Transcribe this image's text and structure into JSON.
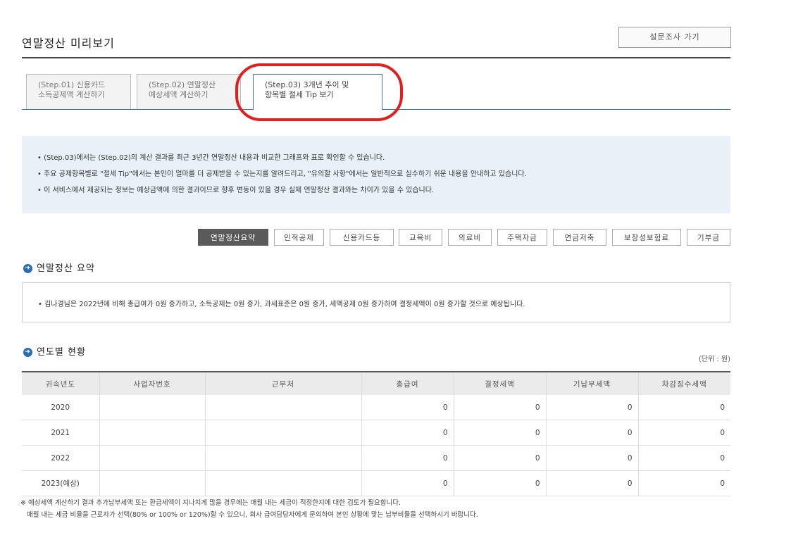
{
  "header": {
    "title": "연말정산 미리보기",
    "survey_button": "설문조사 가기"
  },
  "steps": [
    {
      "line1": "(Step.01) 신용카드",
      "line2": "소득공제액 계산하기"
    },
    {
      "line1": "(Step.02) 연말정산",
      "line2": "예상세액 계산하기"
    },
    {
      "line1": "(Step.03) 3개년 추이 및",
      "line2": "항목별 절세 Tip 보기"
    }
  ],
  "info": [
    "• (Step.03)에서는 (Step.02)의 계산 결과를 최근 3년간 연말정산 내용과 비교한 그래프와 표로 확인할 수 있습니다.",
    "• 주요 공제항목별로 \"절세 Tip\"에서는 본인이 얼마를 더 공제받을 수 있는지를 알려드리고, \"유의할 사항\"에서는 일반적으로 실수하기 쉬운 내용을 안내하고 있습니다.",
    "• 이 서비스에서 제공되는 정보는 예상금액에 의한 결과이므로 향후 변동이 있을 경우 실제 연말정산 결과와는 차이가 있을 수 있습니다."
  ],
  "categories": [
    "연말정산요약",
    "인적공제",
    "신용카드등",
    "교육비",
    "의료비",
    "주택자금",
    "연금저축",
    "보장성보험료",
    "기부금"
  ],
  "summary": {
    "heading": "연말정산 요약",
    "text": "• 김나경님은 2022년에 비해 총급여가 0원 증가하고, 소득공제는 0원 증가, 과세표준은 0원 증가, 세액공제 0원 증가하여 결정세액이 0원 증가할 것으로 예상됩니다."
  },
  "yearly": {
    "heading": "연도별 현황",
    "unit": "(단위 : 원)",
    "columns": [
      "귀속년도",
      "사업자번호",
      "근무처",
      "총급여",
      "결정세액",
      "기납부세액",
      "차감징수세액"
    ],
    "rows": [
      [
        "2020",
        "",
        "",
        "0",
        "0",
        "0",
        "0"
      ],
      [
        "2021",
        "",
        "",
        "0",
        "0",
        "0",
        "0"
      ],
      [
        "2022",
        "",
        "",
        "0",
        "0",
        "0",
        "0"
      ],
      [
        "2023(예상)",
        "",
        "",
        "0",
        "0",
        "0",
        "0"
      ]
    ]
  },
  "notes": [
    "※ 예상세액 계산하기 결과 추가납부세액 또는 환급세액이 지나치게 많을 경우에는 매월 내는 세금이 적정한지에 대한 검토가 필요합니다.",
    "   매월 내는 세금 비율을 근로자가 선택(80% or 100% or 120%)할 수 있으니, 회사 급여담당자에게 문의하여 본인 상황에 맞는 납부비율을 선택하시기 바랍니다."
  ],
  "colors": {
    "accent": "#2a6db2",
    "highlight": "#e01f1f",
    "info_bg": "#e9f0f7"
  }
}
